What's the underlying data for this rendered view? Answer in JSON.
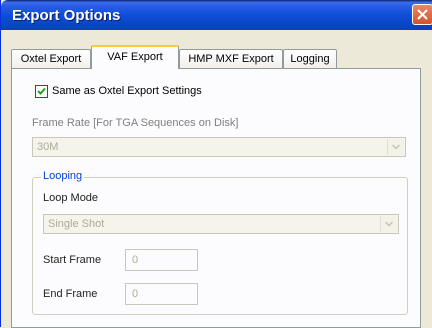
{
  "window": {
    "title": "Export Options"
  },
  "tabs": [
    {
      "label": "Oxtel Export",
      "active": false
    },
    {
      "label": "VAF Export",
      "active": true
    },
    {
      "label": "HMP MXF Export",
      "active": false
    },
    {
      "label": "Logging",
      "active": false
    }
  ],
  "vaf": {
    "same_as_oxtel": {
      "label": "Same as Oxtel Export Settings",
      "checked": true
    },
    "frame_rate": {
      "label": "Frame Rate [For TGA Sequences on Disk]",
      "value": "30M",
      "enabled": false
    },
    "looping": {
      "legend": "Looping",
      "loop_mode": {
        "label": "Loop Mode",
        "value": "Single Shot"
      },
      "start_frame": {
        "label": "Start Frame",
        "value": "0"
      },
      "end_frame": {
        "label": "End Frame",
        "value": "0"
      }
    }
  },
  "icons": {
    "close": "close-icon",
    "checkmark": "checkmark-icon",
    "dropdown": "chevron-down-icon"
  },
  "colors": {
    "title_bar": "#0a46c8",
    "active_tab_accent": "#ffc83c",
    "group_legend": "#0046d5",
    "disabled_text": "#acab99"
  }
}
